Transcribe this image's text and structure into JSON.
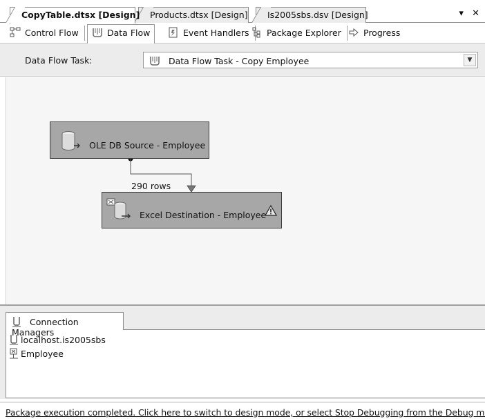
{
  "document_tabs": [
    {
      "label": "CopyTable.dtsx [Design]",
      "active": true
    },
    {
      "label": "Products.dtsx [Design]",
      "active": false
    },
    {
      "label": "Is2005sbs.dsv [Design]",
      "active": false
    }
  ],
  "window_controls": {
    "dropdown": "▾",
    "close": "✕"
  },
  "designer_tabs": [
    {
      "label": "Control Flow",
      "icon": "control-flow-icon",
      "active": false
    },
    {
      "label": "Data Flow",
      "icon": "data-flow-icon",
      "active": true
    },
    {
      "label": "Event Handlers",
      "icon": "event-handlers-icon",
      "active": false
    },
    {
      "label": "Package Explorer",
      "icon": "package-explorer-icon",
      "active": false
    },
    {
      "label": "Progress",
      "icon": "progress-arrow-icon",
      "active": false
    }
  ],
  "task_selector": {
    "label": "Data Flow Task:",
    "value": "Data Flow Task - Copy Employee",
    "dropdown_icon": "chevron-down-icon"
  },
  "canvas": {
    "source": {
      "label": "OLE DB Source - Employee",
      "icon": "database-source-icon"
    },
    "destination": {
      "label": "Excel Destination - Employee",
      "icon": "excel-destination-icon",
      "warning_icon": "warning-triangle-icon"
    },
    "path": {
      "label": "290 rows"
    }
  },
  "connection_managers": {
    "tab_label": "Connection Managers",
    "items": [
      {
        "label": "localhost.is2005sbs",
        "icon": "oledb-connection-icon"
      },
      {
        "label": "Employee",
        "icon": "excel-connection-icon"
      }
    ]
  },
  "status_bar": {
    "message": "Package execution completed. Click here to switch to design mode, or select Stop Debugging from the Debug menu.",
    "icon": "info-icon"
  },
  "colors": {
    "component_fill": "#a7a7a7",
    "canvas_bg": "#f6f6f6",
    "panel_bg": "#ececec"
  }
}
